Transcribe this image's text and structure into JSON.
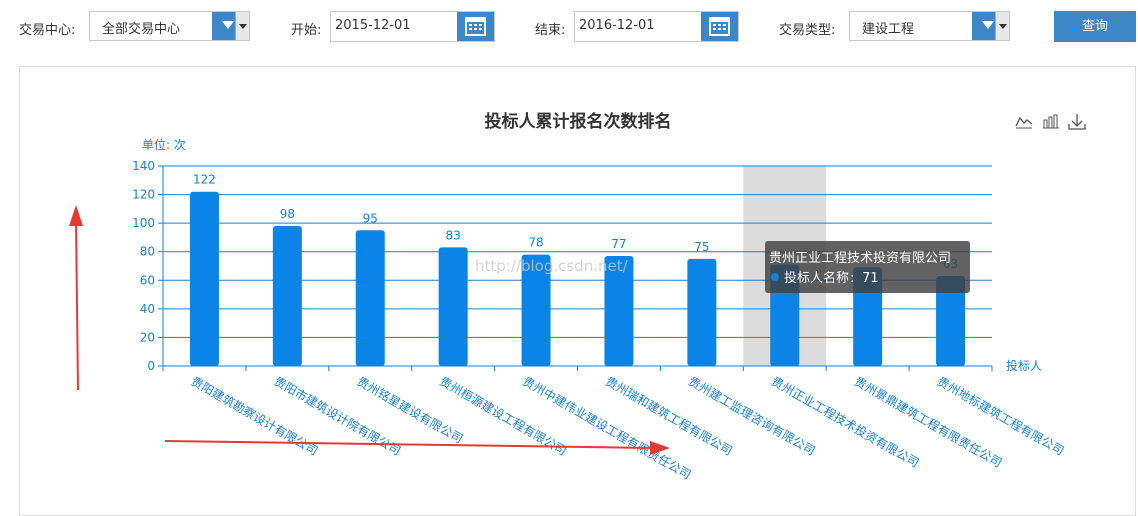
{
  "filters": {
    "center_label": "交易中心:",
    "center_value": "全部交易中心",
    "start_label": "开始:",
    "start_value": "2015-12-01",
    "end_label": "结束:",
    "end_value": "2016-12-01",
    "type_label": "交易类型:",
    "type_value": "建设工程",
    "query_label": "查询"
  },
  "colors": {
    "accent": "#3d87c9",
    "bar": "#0b84e8",
    "axis": "#1a7fd1",
    "highlight": "#dcdcdc",
    "arrow": "#e53935"
  },
  "watermark": "http://blog.csdn.net/",
  "chart_data": {
    "type": "bar",
    "title": "投标人累计报名次数排名",
    "ylabel": "单位: 次",
    "xlabel": "投标人",
    "ylim": [
      0,
      140
    ],
    "yticks": [
      0,
      20,
      40,
      60,
      80,
      100,
      120,
      140
    ],
    "grid": true,
    "categories": [
      "贵阳建筑勘察设计有限公司",
      "贵阳市建筑设计院有限公司",
      "贵州铭星建设有限公司",
      "贵州桓源建设工程有限公司",
      "贵州中建伟业建设工程有限责任公司",
      "贵州瑞和建筑工程有限公司",
      "贵州建工监理咨询有限公司",
      "贵州正业工程技术投资有限公司",
      "贵州景鼎建筑工程有限责任公司",
      "贵州地标建筑工程有限公司"
    ],
    "values": [
      122,
      98,
      95,
      83,
      78,
      77,
      75,
      71,
      69,
      63
    ],
    "data_labels": [
      "122",
      "98",
      "95",
      "83",
      "78",
      "77",
      "75",
      "",
      "",
      "63"
    ],
    "highlight_index": 7,
    "tooltip": {
      "title": "贵州正业工程技术投资有限公司",
      "series": "投标人名称",
      "value": "71"
    }
  }
}
